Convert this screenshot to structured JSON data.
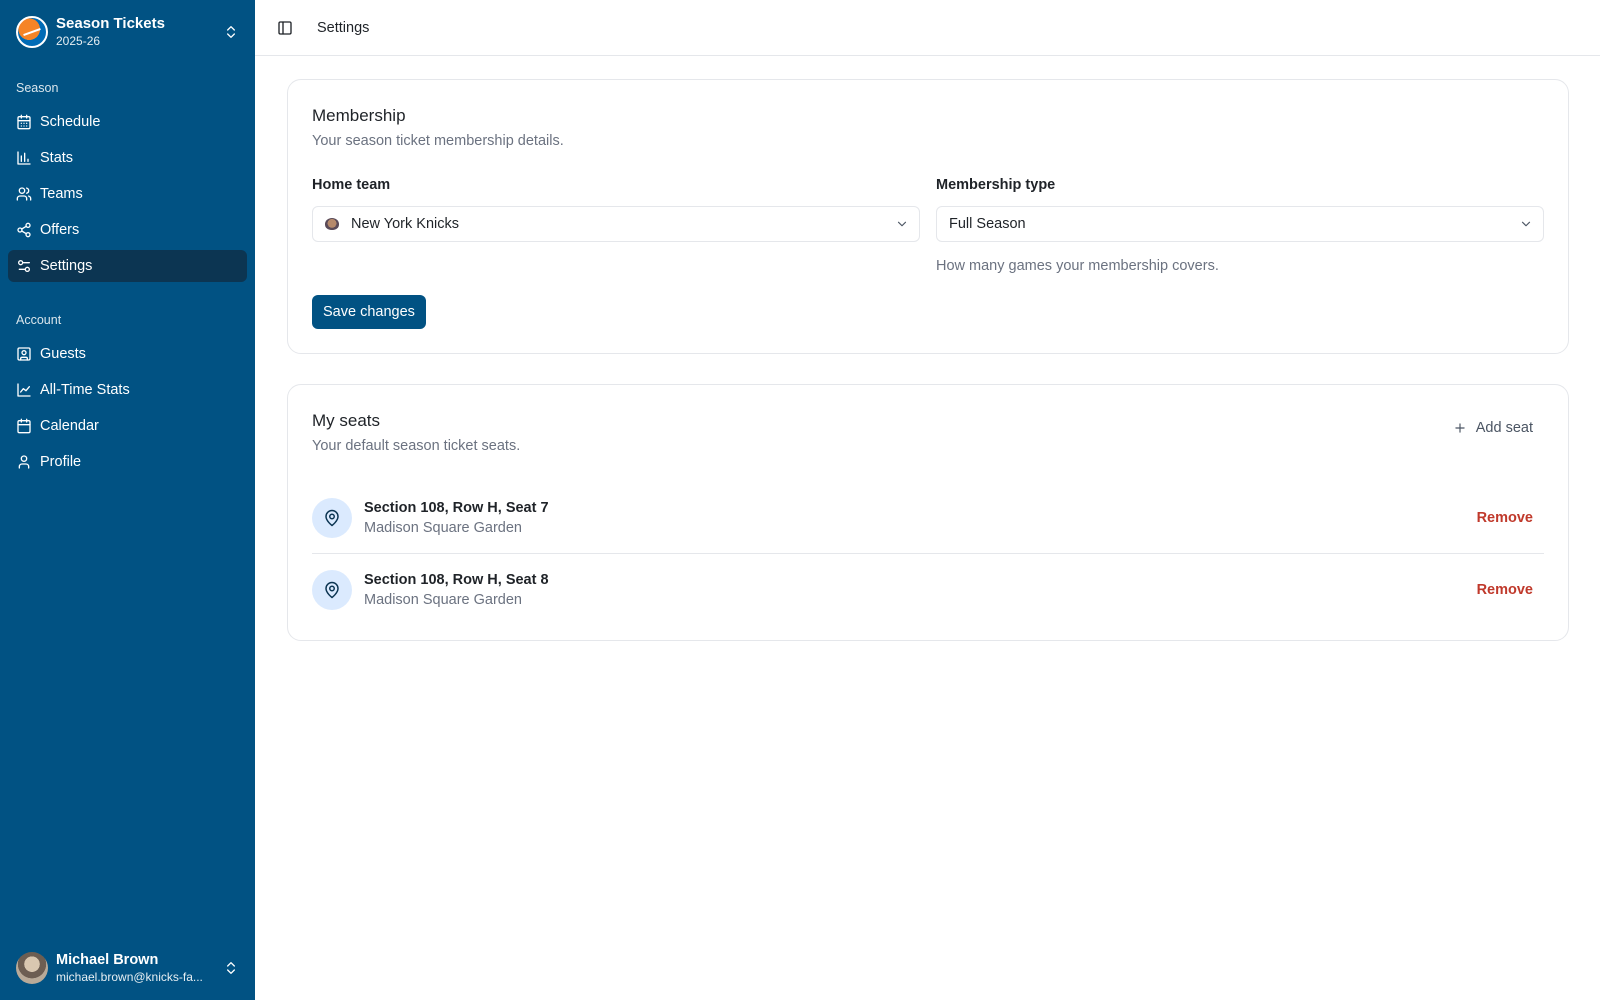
{
  "sidebar": {
    "brand": {
      "title": "Season Tickets",
      "subtitle": "2025-26"
    },
    "season_label": "Season",
    "season_items": [
      {
        "label": "Schedule",
        "icon": "calendar-grid-icon"
      },
      {
        "label": "Stats",
        "icon": "bar-chart-icon"
      },
      {
        "label": "Teams",
        "icon": "users-icon"
      },
      {
        "label": "Offers",
        "icon": "share-icon"
      },
      {
        "label": "Settings",
        "icon": "sliders-icon",
        "active": true
      }
    ],
    "account_label": "Account",
    "account_items": [
      {
        "label": "Guests",
        "icon": "contact-icon"
      },
      {
        "label": "All-Time Stats",
        "icon": "line-chart-icon"
      },
      {
        "label": "Calendar",
        "icon": "calendar-icon"
      },
      {
        "label": "Profile",
        "icon": "user-icon"
      }
    ],
    "user": {
      "name": "Michael Brown",
      "email": "michael.brown@knicks-fa..."
    }
  },
  "topbar": {
    "title": "Settings"
  },
  "membership": {
    "title": "Membership",
    "description": "Your season ticket membership details.",
    "home_team": {
      "label": "Home team",
      "value": "New York Knicks"
    },
    "membership_type": {
      "label": "Membership type",
      "value": "Full Season",
      "helper": "How many games your membership covers."
    },
    "save_label": "Save changes"
  },
  "seats": {
    "title": "My seats",
    "description": "Your default season ticket seats.",
    "add_label": "Add seat",
    "items": [
      {
        "title": "Section 108, Row H, Seat 7",
        "venue": "Madison Square Garden",
        "action": "Remove"
      },
      {
        "title": "Section 108, Row H, Seat 8",
        "venue": "Madison Square Garden",
        "action": "Remove"
      }
    ]
  },
  "colors": {
    "sidebar": "#015283",
    "active": "#0c3552",
    "danger": "#c0392b"
  }
}
